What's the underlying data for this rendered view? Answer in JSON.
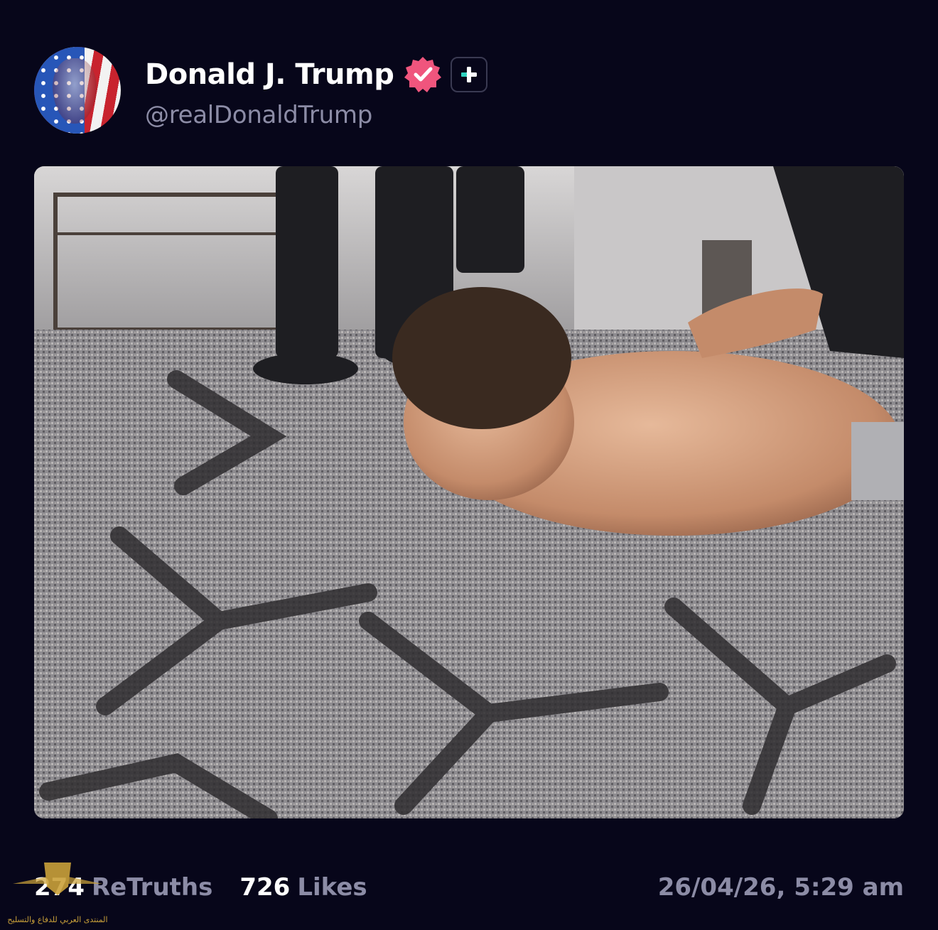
{
  "post": {
    "author": {
      "display_name": "Donald J. Trump",
      "handle": "@realDonaldTrump",
      "verified_icon": "verified-badge-icon",
      "plus_icon": "plus-icon"
    },
    "media": {
      "kind": "photo"
    },
    "stats": {
      "retruths_count": "274",
      "retruths_label": "ReTruths",
      "likes_count": "726",
      "likes_label": "Likes"
    },
    "timestamp": "26/04/26, 5:29 am"
  },
  "watermark": {
    "logo_icon": "forum-logo-icon",
    "text": "المنتدى العربي للدفاع والتسليح"
  },
  "colors": {
    "background": "#07061a",
    "muted_text": "#8c8ca6",
    "verified_pink": "#f0557d",
    "plus_accent": "#2fd3c0"
  }
}
